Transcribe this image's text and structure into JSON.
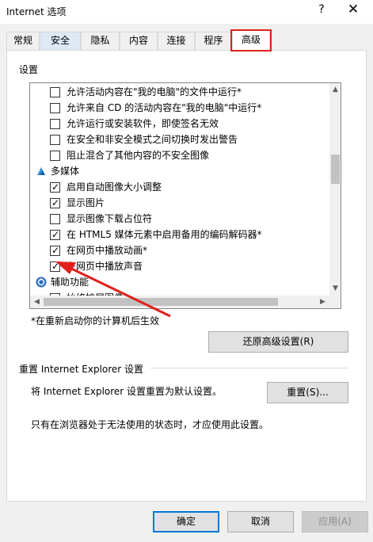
{
  "window": {
    "title": "Internet 选项",
    "help_glyph": "?",
    "close_glyph": "✕"
  },
  "tabs": [
    {
      "label": "常规"
    },
    {
      "label": "安全"
    },
    {
      "label": "隐私"
    },
    {
      "label": "内容"
    },
    {
      "label": "连接"
    },
    {
      "label": "程序"
    },
    {
      "label": "高级"
    }
  ],
  "active_tab": "高级",
  "settings": {
    "group_label": "设置",
    "items": [
      {
        "type": "checkbox",
        "checked": false,
        "label": "允许活动内容在\"我的电脑\"的文件中运行*"
      },
      {
        "type": "checkbox",
        "checked": false,
        "label": "允许来自 CD 的活动内容在\"我的电脑\"中运行*"
      },
      {
        "type": "checkbox",
        "checked": false,
        "label": "允许运行或安装软件，即使签名无效"
      },
      {
        "type": "checkbox",
        "checked": false,
        "label": "在安全和非安全模式之间切换时发出警告"
      },
      {
        "type": "checkbox",
        "checked": false,
        "label": "阻止混合了其他内容的不安全图像"
      },
      {
        "type": "category",
        "icon": "multimedia-icon",
        "label": "多媒体"
      },
      {
        "type": "checkbox",
        "checked": true,
        "label": "启用自动图像大小调整"
      },
      {
        "type": "checkbox",
        "checked": true,
        "label": "显示图片"
      },
      {
        "type": "checkbox",
        "checked": false,
        "label": "显示图像下载占位符"
      },
      {
        "type": "checkbox",
        "checked": true,
        "label": "在 HTML5 媒体元素中启用备用的编码解码器*"
      },
      {
        "type": "checkbox",
        "checked": true,
        "label": "在网页中播放动画*"
      },
      {
        "type": "checkbox",
        "checked": true,
        "label": "在网页中播放声音"
      },
      {
        "type": "category",
        "icon": "accessibility-icon",
        "label": "辅助功能"
      },
      {
        "type": "checkbox",
        "checked": false,
        "label": "始终扩展图像"
      }
    ],
    "restart_note": "*在重新启动你的计算机后生效",
    "restore_button": "还原高级设置(R)"
  },
  "reset": {
    "group_label": "重置 Internet Explorer 设置",
    "description": "将 Internet Explorer 设置重置为默认设置。",
    "button": "重置(S)...",
    "note": "只有在浏览器处于无法使用的状态时，才应使用此设置。"
  },
  "footer": {
    "ok": "确定",
    "cancel": "取消",
    "apply": "应用(A)"
  },
  "colors": {
    "highlight_red": "#e0201b",
    "accent_blue": "#0078d7"
  }
}
